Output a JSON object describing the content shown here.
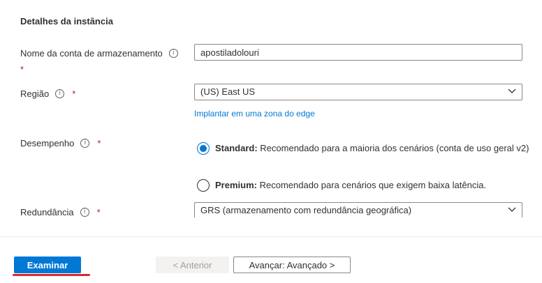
{
  "section": {
    "title": "Detalhes da instância"
  },
  "fields": {
    "storage_account": {
      "label": "Nome da conta de armazenamento",
      "value": "apostiladolouri",
      "required_mark": "*"
    },
    "region": {
      "label": "Região",
      "value": "(US) East US",
      "required_mark": "*",
      "edge_link": "Implantar em uma zona do edge"
    },
    "performance": {
      "label": "Desempenho",
      "required_mark": "*",
      "options": [
        {
          "name": "Standard:",
          "description": "Recomendado para a maioria dos cenários (conta de uso geral v2)",
          "selected": true
        },
        {
          "name": "Premium:",
          "description": "Recomendado para cenários que exigem baixa latência.",
          "selected": false
        }
      ]
    },
    "redundancy": {
      "label": "Redundância",
      "value": "GRS (armazenamento com redundância geográfica)",
      "required_mark": "*"
    }
  },
  "footer": {
    "review_button": "Examinar",
    "previous_button": "< Anterior",
    "next_button": "Avançar: Avançado >"
  },
  "icons": {
    "info": "info-icon",
    "chevron": "chevron-down-icon"
  },
  "colors": {
    "accent": "#0078d4",
    "required": "#a4262c",
    "highlight": "#d9282f"
  }
}
